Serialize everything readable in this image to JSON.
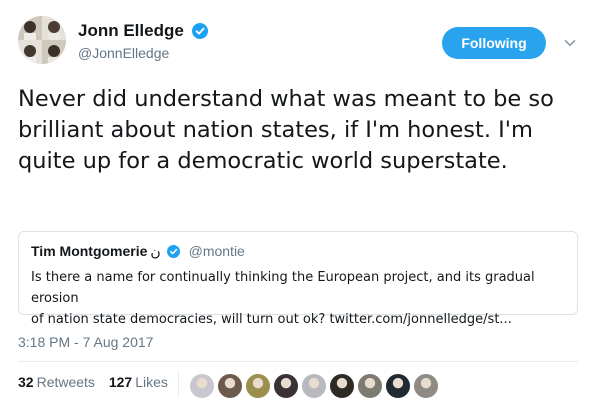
{
  "tweet": {
    "author": {
      "display_name": "Jonn Elledge",
      "handle": "@JonnElledge"
    },
    "follow_button_label": "Following",
    "text": "Never did understand what was meant to be so brilliant about nation states, if I'm honest. I'm quite up for a democratic world superstate.",
    "quoted": {
      "display_name": "Tim Montgomerie",
      "name_glyph": "ن",
      "handle": "@montie",
      "text": "Is there a name for continually thinking the European project, and its gradual erosion\nof nation state democracies, will turn out ok? twitter.com/jonnelledge/st..."
    },
    "timestamp": "3:18 PM - 7 Aug 2017",
    "stats": {
      "retweets_count": "32",
      "retweets_label": "Retweets",
      "likes_count": "127",
      "likes_label": "Likes"
    },
    "liker_avatar_colors": [
      "#c9c6cf",
      "#6e5a4c",
      "#9a8f4e",
      "#3b3238",
      "#b8b9bd",
      "#2e2a24",
      "#7d7a72",
      "#1f2a33",
      "#8f8a84"
    ]
  },
  "colors": {
    "accent": "#2aa3ef",
    "verified": "#1da1f2",
    "secondary_text": "#657786"
  }
}
